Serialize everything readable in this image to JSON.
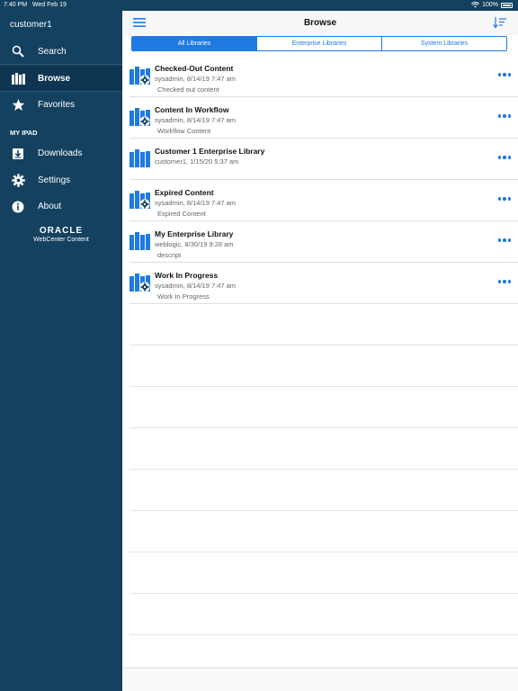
{
  "status": {
    "time": "7:40 PM",
    "date": "Wed Feb 19",
    "battery": "100%"
  },
  "sidebar": {
    "user": "customer1",
    "items": [
      {
        "label": "Search",
        "icon": "search-icon"
      },
      {
        "label": "Browse",
        "icon": "library-icon"
      },
      {
        "label": "Favorites",
        "icon": "star-icon"
      }
    ],
    "section_header": "MY IPAD",
    "device_items": [
      {
        "label": "Downloads",
        "icon": "download-icon"
      },
      {
        "label": "Settings",
        "icon": "gear-icon"
      },
      {
        "label": "About",
        "icon": "info-icon"
      }
    ],
    "logo": {
      "line1": "ORACLE",
      "line2": "WebCenter Content"
    }
  },
  "header": {
    "title": "Browse"
  },
  "tabs": [
    {
      "label": "All Libraries",
      "active": true
    },
    {
      "label": "Enterprise Libraries",
      "active": false
    },
    {
      "label": "System Libraries",
      "active": false
    }
  ],
  "libraries": [
    {
      "name": "Checked-Out Content",
      "meta": "sysadmin, 8/14/19 7:47 am",
      "desc": "Checked out content",
      "icon": "system-library-icon"
    },
    {
      "name": "Content In Workflow",
      "meta": "sysadmin, 8/14/19 7:47 am",
      "desc": "Workflow Content",
      "icon": "system-library-icon"
    },
    {
      "name": "Customer 1 Enterprise Library",
      "meta": "customer1, 1/15/20 5:37 am",
      "desc": "",
      "icon": "enterprise-library-icon"
    },
    {
      "name": "Expired Content",
      "meta": "sysadmin, 8/14/19 7:47 am",
      "desc": "Expired Content",
      "icon": "system-library-icon"
    },
    {
      "name": "My Enterprise Library",
      "meta": "weblogic, 8/30/19 9:28 am",
      "desc": "descript",
      "icon": "enterprise-library-icon"
    },
    {
      "name": "Work In Progress",
      "meta": "sysadmin, 8/14/19 7:47 am",
      "desc": "Work In Progress",
      "icon": "system-library-icon"
    }
  ],
  "colors": {
    "sidebar": "#14415f",
    "accent": "#1f7ae3",
    "sidebar_active": "#0f3651"
  }
}
